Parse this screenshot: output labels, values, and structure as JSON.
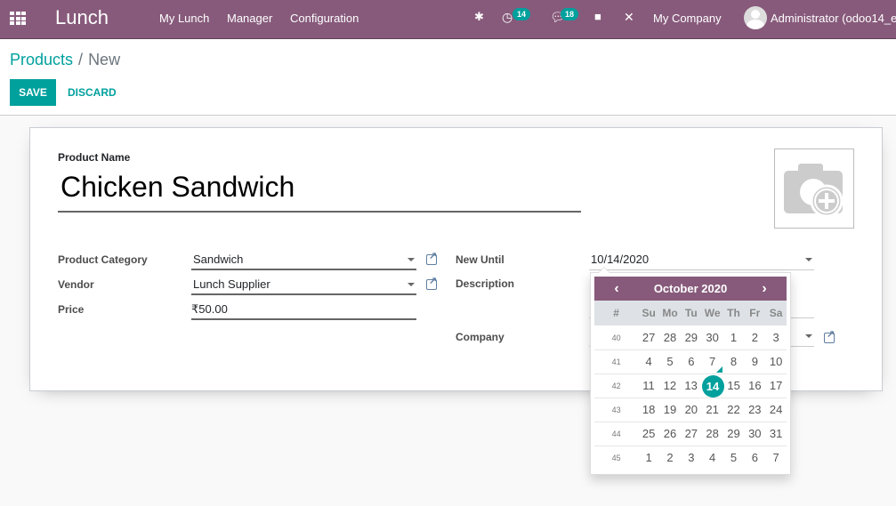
{
  "navbar": {
    "app_name": "Lunch",
    "menu": [
      "My Lunch",
      "Manager",
      "Configuration"
    ],
    "activity_count": "14",
    "messages_count": "18",
    "company": "My Company",
    "user": "Administrator (odoo14_e"
  },
  "breadcrumb": {
    "parent": "Products",
    "separator": "/",
    "current": "New"
  },
  "buttons": {
    "save": "SAVE",
    "discard": "DISCARD"
  },
  "form": {
    "product_name_label": "Product Name",
    "product_name": "Chicken Sandwich",
    "category_label": "Product Category",
    "category": "Sandwich",
    "vendor_label": "Vendor",
    "vendor": "Lunch Supplier",
    "price_label": "Price",
    "price": "₹50.00",
    "new_until_label": "New Until",
    "new_until": "10/14/2020",
    "description_label": "Description",
    "company_label": "Company"
  },
  "datepicker": {
    "title": "October 2020",
    "prev": "‹",
    "next": "›",
    "week_header": "#",
    "dow": [
      "Su",
      "Mo",
      "Tu",
      "We",
      "Th",
      "Fr",
      "Sa"
    ],
    "weeks": [
      {
        "num": "40",
        "days": [
          "27",
          "28",
          "29",
          "30",
          "1",
          "2",
          "3"
        ]
      },
      {
        "num": "41",
        "days": [
          "4",
          "5",
          "6",
          "7",
          "8",
          "9",
          "10"
        ]
      },
      {
        "num": "42",
        "days": [
          "11",
          "12",
          "13",
          "14",
          "15",
          "16",
          "17"
        ]
      },
      {
        "num": "43",
        "days": [
          "18",
          "19",
          "20",
          "21",
          "22",
          "23",
          "24"
        ]
      },
      {
        "num": "44",
        "days": [
          "25",
          "26",
          "27",
          "28",
          "29",
          "30",
          "31"
        ]
      },
      {
        "num": "45",
        "days": [
          "1",
          "2",
          "3",
          "4",
          "5",
          "6",
          "7"
        ]
      }
    ],
    "selected": "14",
    "today": "7",
    "accent": "#00a09d",
    "header_color": "#875a7b"
  }
}
